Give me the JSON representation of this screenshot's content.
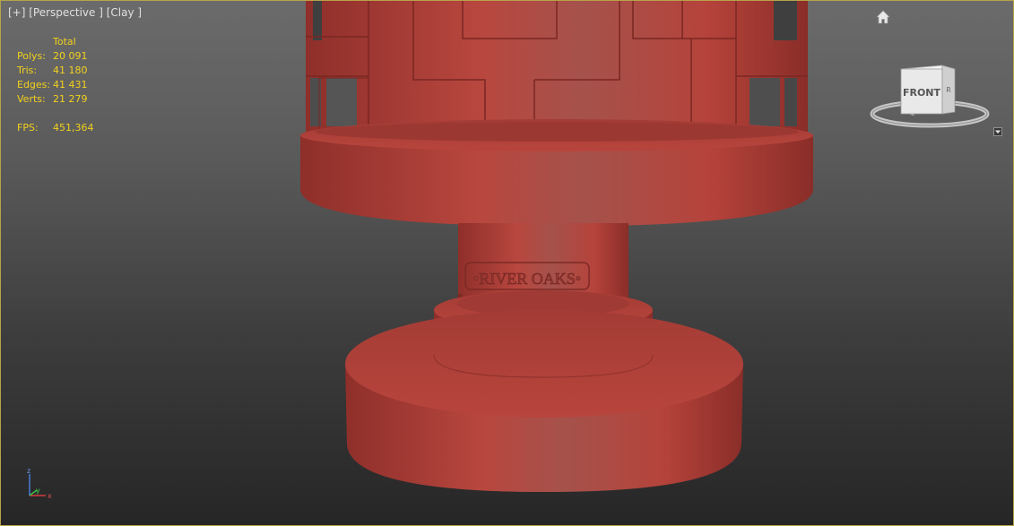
{
  "viewport": {
    "label": "[+] [Perspective ] [Clay ]"
  },
  "stats": {
    "header": "Total",
    "rows": [
      {
        "key": "Polys:",
        "value": "20 091"
      },
      {
        "key": "Tris:",
        "value": "41 180"
      },
      {
        "key": "Edges:",
        "value": "41 431"
      },
      {
        "key": "Verts:",
        "value": "21 279"
      }
    ],
    "fps_key": "FPS:",
    "fps_value": "451,364"
  },
  "model": {
    "engraving": "•RIVER OAKS•"
  },
  "viewcube": {
    "face": "FRONT",
    "side_face": "R",
    "icons": [
      "home-icon",
      "dropdown-arrow-icon"
    ]
  },
  "axis": {
    "x": "x",
    "y": "y",
    "z": "z"
  },
  "colors": {
    "viewport_border": "#b8a24a",
    "stats_text": "#f2d11d",
    "clay": "#b8433c"
  }
}
